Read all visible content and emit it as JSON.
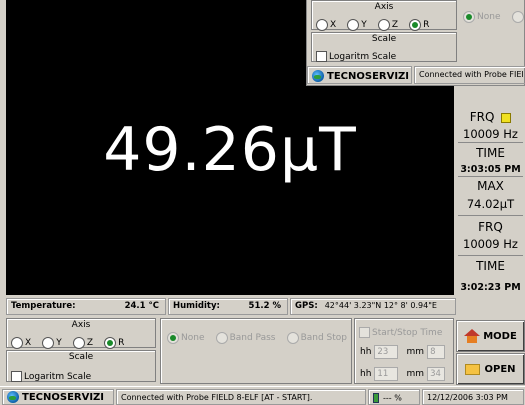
{
  "display": {
    "reading": "49.26µT"
  },
  "side_panel": {
    "frq1_label": "FRQ",
    "frq1_value": "10009 Hz",
    "time1_label": "TIME",
    "time1_value": "3:03:05 PM",
    "max_label": "MAX",
    "max_value": "74.02µT",
    "frq2_label": "FRQ",
    "frq2_value": "10009 Hz",
    "time2_label": "TIME",
    "time2_value": "3:02:23 PM"
  },
  "status": {
    "temperature_label": "Temperature:",
    "temperature_value": "24.1 °C",
    "humidity_label": "Humidity:",
    "humidity_value": "51.2 %",
    "gps_label": "GPS:",
    "gps_value": "42°44' 3.23\"N   12° 8' 0.94\"E"
  },
  "axis": {
    "title": "Axis",
    "options": [
      "X",
      "Y",
      "Z",
      "R"
    ],
    "selected": "R"
  },
  "scale": {
    "title": "Scale",
    "checkbox_label": "Logaritm Scale"
  },
  "filter": {
    "options": [
      "None",
      "Band Pass",
      "Band Stop"
    ]
  },
  "startstop": {
    "label": "Start/Stop Time",
    "hh_label": "hh",
    "mm_label": "mm",
    "start_hh": "23",
    "start_mm": "8",
    "stop_hh": "11",
    "stop_mm": "34"
  },
  "buttons": {
    "mode": "MODE",
    "open": "OPEN"
  },
  "bottom_bar": {
    "brand": "TECNOSERVIZI",
    "connection": "Connected with Probe FIELD 8-ELF [AT - START].",
    "battery": "--- %",
    "datetime": "12/12/2006 3:03 PM"
  },
  "popup": {
    "axis_title": "Axis",
    "scale_title": "Scale",
    "scale_label": "Logaritm Scale",
    "filter_option": "None",
    "brand": "TECNOSERVIZI",
    "connection": "Connected with Probe FIEI"
  }
}
